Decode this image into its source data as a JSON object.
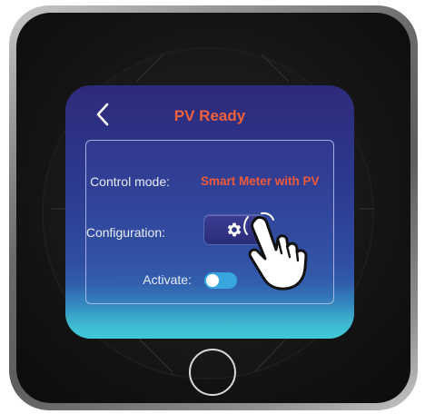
{
  "screen": {
    "title": "PV Ready",
    "back_icon": "chevron-left-icon",
    "title_color": "#f0603a"
  },
  "settings": {
    "control_mode_label": "Control mode:",
    "control_mode_value": "Smart Meter with PV",
    "configuration_label": "Configuration:",
    "configuration_icon": "gear-icon",
    "activate_label": "Activate:",
    "activate_on": true
  },
  "colors": {
    "accent": "#f05a3a",
    "toggle_on": "#3aa6e0",
    "screen_top": "#2e2a7a",
    "screen_bottom": "#41c6cf"
  },
  "overlay": {
    "pointer_icon": "hand-pointer-icon"
  }
}
